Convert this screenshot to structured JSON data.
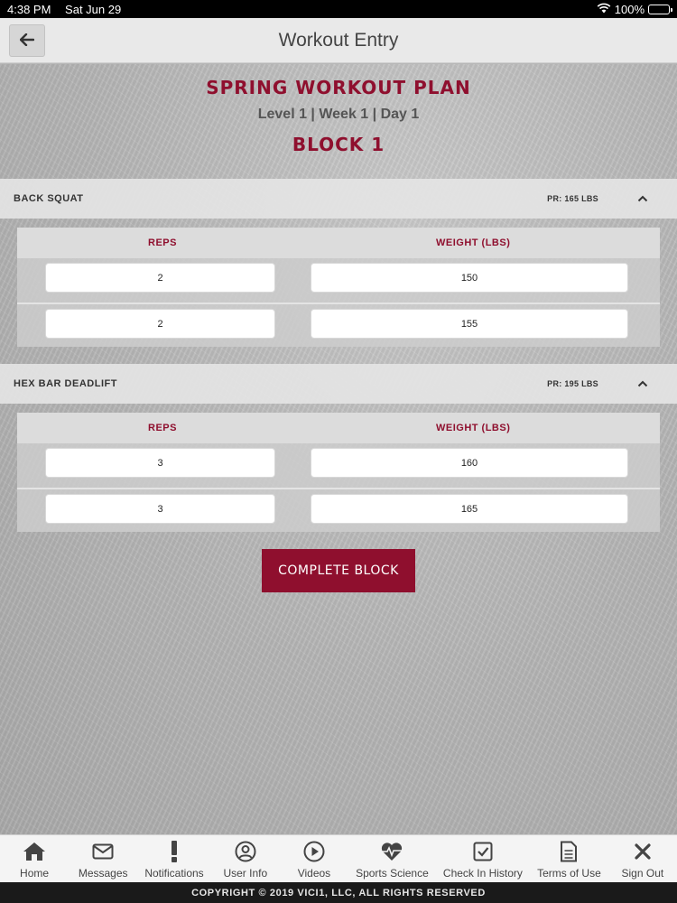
{
  "status_bar": {
    "time": "4:38 PM",
    "date": "Sat Jun 29",
    "battery": "100%"
  },
  "navbar": {
    "title": "Workout Entry"
  },
  "plan": {
    "title": "SPRING WORKOUT PLAN",
    "subtitle": "Level 1 | Week 1 | Day 1",
    "block": "BLOCK 1"
  },
  "exercises": [
    {
      "name": "BACK SQUAT",
      "pr": "PR: 165 LBS",
      "reps_header": "REPS",
      "weight_header": "WEIGHT (LBS)",
      "sets": [
        {
          "reps": "2",
          "weight": "150"
        },
        {
          "reps": "2",
          "weight": "155"
        }
      ]
    },
    {
      "name": "HEX BAR DEADLIFT",
      "pr": "PR: 195 LBS",
      "reps_header": "REPS",
      "weight_header": "WEIGHT (LBS)",
      "sets": [
        {
          "reps": "3",
          "weight": "160"
        },
        {
          "reps": "3",
          "weight": "165"
        }
      ]
    }
  ],
  "complete_button": "COMPLETE BLOCK",
  "tabs": [
    {
      "label": "Home",
      "icon": "home-icon"
    },
    {
      "label": "Messages",
      "icon": "envelope-icon"
    },
    {
      "label": "Notifications",
      "icon": "exclamation-icon"
    },
    {
      "label": "User Info",
      "icon": "user-icon"
    },
    {
      "label": "Videos",
      "icon": "play-icon"
    },
    {
      "label": "Sports Science",
      "icon": "heartbeat-icon"
    },
    {
      "label": "Check In History",
      "icon": "checkbox-icon"
    },
    {
      "label": "Terms of Use",
      "icon": "document-icon"
    },
    {
      "label": "Sign Out",
      "icon": "close-icon"
    }
  ],
  "footer": "COPYRIGHT © 2019 VICI1, LLC, ALL RIGHTS RESERVED",
  "colors": {
    "accent": "#8f0f2e",
    "footer_bg": "#1a1a1a"
  }
}
